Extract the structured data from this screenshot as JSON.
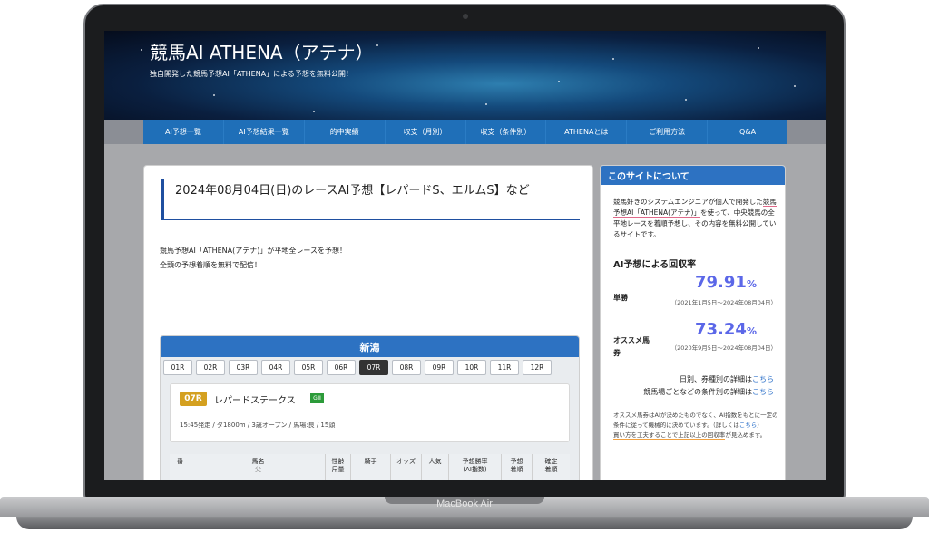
{
  "site": {
    "title": "競馬AI ATHENA（アテナ）",
    "subtitle": "独自開発した競馬予想AI「ATHENA」による予想を無料公開！"
  },
  "nav": [
    "AI予想一覧",
    "AI予想結果一覧",
    "的中実績",
    "収支（月別）",
    "収支（条件別）",
    "ATHENAとは",
    "ご利用方法",
    "Q&A"
  ],
  "post": {
    "title": "2024年08月04日(日)のレースAI予想【レパードS、エルムS】など",
    "intro_1": "競馬予想AI「ATHENA(アテナ)」が平地全レースを予想！",
    "intro_2": "全頭の予想着順を無料で配信！"
  },
  "race": {
    "venue": "新潟",
    "tabs": [
      "01R",
      "02R",
      "03R",
      "04R",
      "05R",
      "06R",
      "07R",
      "08R",
      "09R",
      "10R",
      "11R",
      "12R"
    ],
    "active_tab": "07R",
    "number": "07R",
    "name": "レパードステークス",
    "grade": "GⅢ",
    "info": "15:45発走 / ダ1800m / 3歳オープン / 馬場:良 / 15頭",
    "headers": {
      "ban": "番",
      "horse": "馬名",
      "horse_sub": "父",
      "sex_age": "性齢",
      "weight": "斤量",
      "jockey": "騎手",
      "odds": "オッズ",
      "popularity": "人気",
      "win_rate": "予想勝率",
      "ai_index": "(AI指数)",
      "pred_rank_1": "予想",
      "pred_rank_2": "着順",
      "final_1": "確定",
      "final_2": "着順"
    }
  },
  "sidebar": {
    "heading": "このサイトについて",
    "about_1": "競馬好きのシステムエンジニアが個人で開発した",
    "about_u1": "競馬予想AI「ATHENA(アテナ)」",
    "about_2": "を使って、中央競馬の全平地レースを",
    "about_u2": "着順予想",
    "about_3": "し、その内容を",
    "about_u3": "無料公開",
    "about_4": "しているサイトです。",
    "rate_heading": "AI予想による回収率",
    "tansho_label": "単勝",
    "tansho_value": "79.91",
    "tansho_period": "（2021年1月5日～2024年08月04日）",
    "osusume_label_1": "オススメ馬",
    "osusume_label_2": "券",
    "osusume_value": "73.24",
    "osusume_period": "（2020年9月5日～2024年08月04日）",
    "percent": "%",
    "detail_1": "日別、券種別の詳細は",
    "detail_2": "競馬場ごとなどの条件別の詳細は",
    "link": "こちら",
    "note_1": "オススメ馬券はAIが決めたものでなく、AI指数をもとに一定の条件に従って機械的に決めています。（詳しくは",
    "note_link": "こちら",
    "note_2": "）",
    "note_u": "買い方を工夫することで上記以上の回収率",
    "note_3": "が見込めます。"
  },
  "device": {
    "label": "MacBook Air"
  }
}
